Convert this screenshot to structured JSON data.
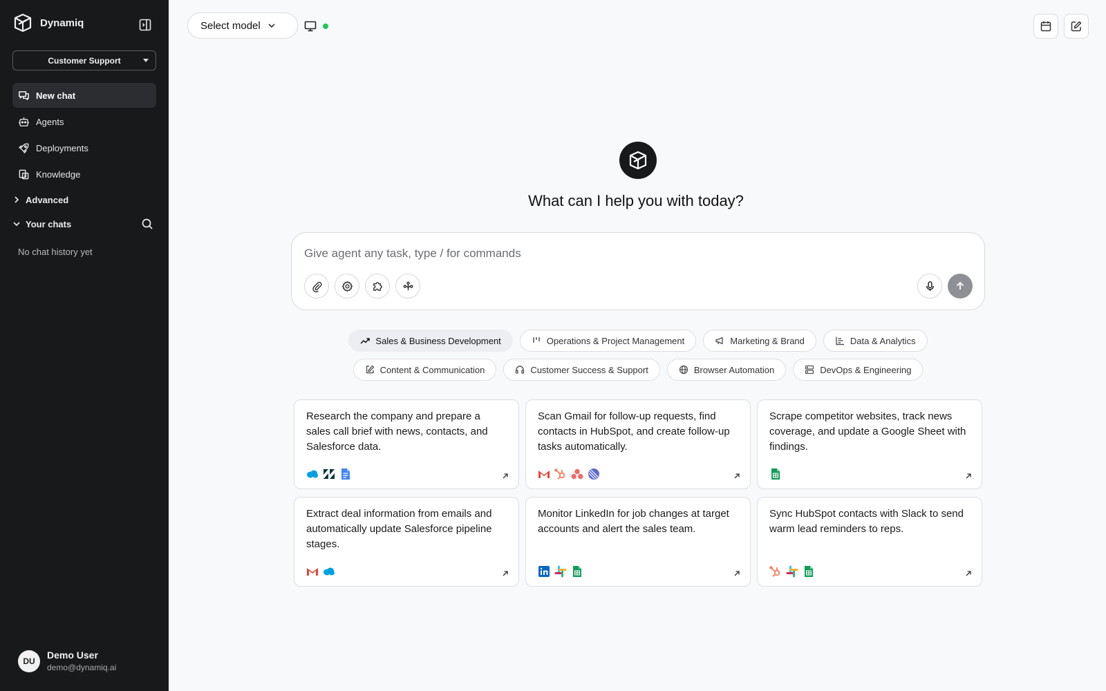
{
  "app": {
    "name": "Dynamiq"
  },
  "sidebar": {
    "workspace": "Customer Support",
    "nav": [
      {
        "label": "New chat",
        "icon": "chat-icon",
        "active": true
      },
      {
        "label": "Agents",
        "icon": "robot-icon"
      },
      {
        "label": "Deployments",
        "icon": "rocket-icon"
      },
      {
        "label": "Knowledge",
        "icon": "knowledge-icon"
      }
    ],
    "advanced_label": "Advanced",
    "your_chats_label": "Your chats",
    "empty_history": "No chat history yet",
    "user": {
      "initials": "DU",
      "name": "Demo User",
      "email": "demo@dynamiq.ai"
    }
  },
  "topbar": {
    "model_label": "Select model",
    "status_color": "#22c55e"
  },
  "main": {
    "heading": "What can I help you with today?",
    "composer": {
      "placeholder": "Give agent any task, type / for commands",
      "tools": [
        "paperclip-icon",
        "gear-icon",
        "puzzle-icon",
        "tree-icon"
      ]
    },
    "categories": [
      {
        "label": "Sales & Business Development",
        "icon": "trend-up-icon",
        "active": true
      },
      {
        "label": "Operations & Project Management",
        "icon": "kanban-icon"
      },
      {
        "label": "Marketing & Brand",
        "icon": "megaphone-icon"
      },
      {
        "label": "Data & Analytics",
        "icon": "bar-chart-icon"
      },
      {
        "label": "Content & Communication",
        "icon": "edit-icon"
      },
      {
        "label": "Customer Success & Support",
        "icon": "headphones-icon"
      },
      {
        "label": "Browser Automation",
        "icon": "globe-icon"
      },
      {
        "label": "DevOps & Engineering",
        "icon": "server-icon"
      }
    ],
    "cards": [
      {
        "text": "Research the company and prepare a sales call brief with news, contacts, and Salesforce data.",
        "apps": [
          "salesforce",
          "zendesk",
          "google-docs"
        ]
      },
      {
        "text": "Scan Gmail for follow-up requests, find contacts in HubSpot, and create follow-up tasks automatically.",
        "apps": [
          "gmail",
          "hubspot",
          "asana",
          "linear"
        ]
      },
      {
        "text": "Scrape competitor websites, track news coverage, and update a Google Sheet with findings.",
        "apps": [
          "google-sheets"
        ]
      },
      {
        "text": "Extract deal information from emails and automatically update Salesforce pipeline stages.",
        "apps": [
          "gmail",
          "salesforce"
        ]
      },
      {
        "text": "Monitor LinkedIn for job changes at target accounts and alert the sales team.",
        "apps": [
          "linkedin",
          "slack",
          "google-sheets"
        ]
      },
      {
        "text": "Sync HubSpot contacts with Slack to send warm lead reminders to reps.",
        "apps": [
          "hubspot",
          "slack",
          "google-sheets"
        ]
      }
    ]
  }
}
